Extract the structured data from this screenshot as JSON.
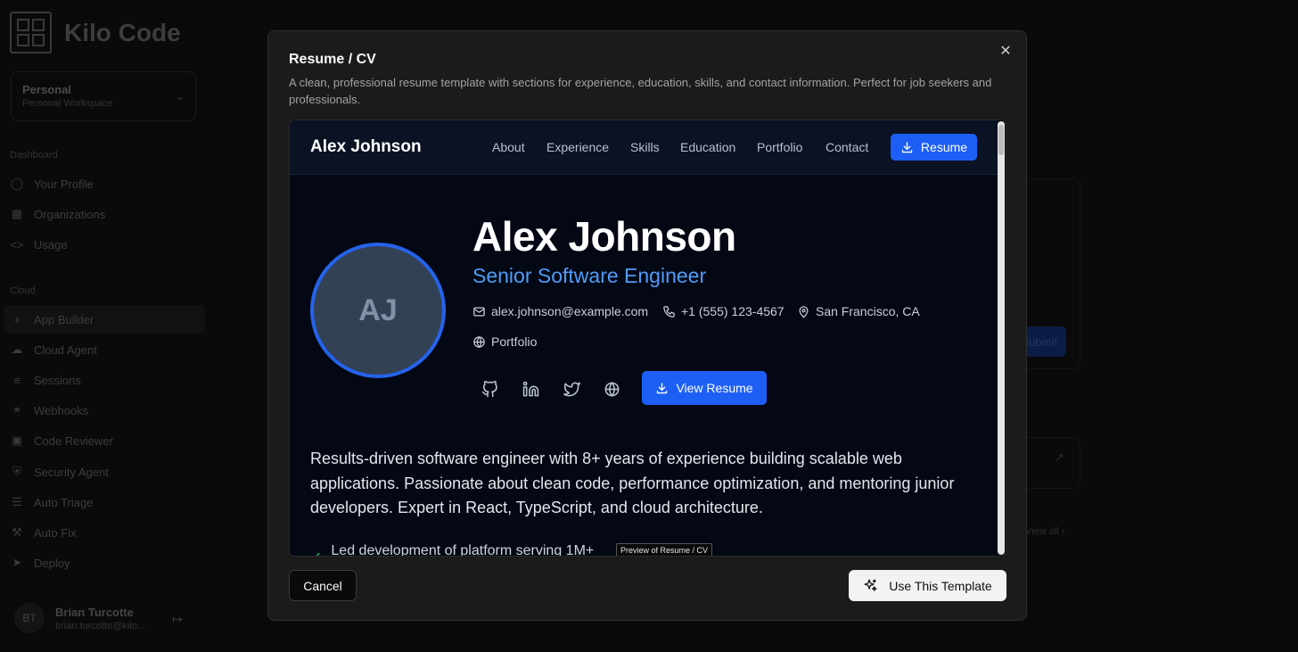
{
  "app": {
    "brand": "Kilo Code",
    "workspace": {
      "name": "Personal",
      "subtitle": "Personal Workspace"
    },
    "sections": {
      "dashboard": "Dashboard",
      "cloud": "Cloud"
    },
    "nav_dashboard": [
      {
        "label": "Your Profile",
        "icon": "user-icon"
      },
      {
        "label": "Organizations",
        "icon": "building-icon"
      },
      {
        "label": "Usage",
        "icon": "code-icon"
      }
    ],
    "nav_cloud": [
      {
        "label": "App Builder",
        "icon": "plus-icon"
      },
      {
        "label": "Cloud Agent",
        "icon": "cloud-icon"
      },
      {
        "label": "Sessions",
        "icon": "list-icon"
      },
      {
        "label": "Webhooks",
        "icon": "webhook-icon"
      },
      {
        "label": "Code Reviewer",
        "icon": "bot-icon"
      },
      {
        "label": "Security Agent",
        "icon": "shield-icon"
      },
      {
        "label": "Auto Triage",
        "icon": "checklist-icon"
      },
      {
        "label": "Auto Fix",
        "icon": "wrench-icon"
      },
      {
        "label": "Deploy",
        "icon": "rocket-icon"
      }
    ],
    "user": {
      "initials": "BT",
      "name": "Brian Turcotte",
      "email": "brian.turcotte@kilo..."
    },
    "background": {
      "submit_label": "Submit",
      "view_all": "View all",
      "truncated": "r..."
    }
  },
  "modal": {
    "title": "Resume / CV",
    "description": "A clean, professional resume template with sections for experience, education, skills, and contact information. Perfect for job seekers and professionals.",
    "tooltip": "Preview of Resume / CV",
    "cancel_label": "Cancel",
    "use_label": "Use This Template",
    "preview": {
      "brand": "Alex Johnson",
      "nav_links": [
        "About",
        "Experience",
        "Skills",
        "Education",
        "Portfolio",
        "Contact"
      ],
      "resume_button": "Resume",
      "avatar_initials": "AJ",
      "name": "Alex Johnson",
      "role": "Senior Software Engineer",
      "email": "alex.johnson@example.com",
      "phone": "+1 (555) 123-4567",
      "location": "San Francisco, CA",
      "portfolio": "Portfolio",
      "social_icons": [
        "github-icon",
        "linkedin-icon",
        "twitter-icon",
        "globe-icon"
      ],
      "view_resume_button": "View Resume",
      "summary": "Results-driven software engineer with 8+ years of experience building scalable web applications. Passionate about clean code, performance optimization, and mentoring junior developers. Expert in React, TypeScript, and cloud architecture.",
      "bullet_1": "Led development of platform serving 1M+"
    }
  },
  "colors": {
    "accent": "#1d5ff5",
    "role_text": "#4f9cf9",
    "check": "#22c55e",
    "modal_bg": "#1b1b1b"
  }
}
